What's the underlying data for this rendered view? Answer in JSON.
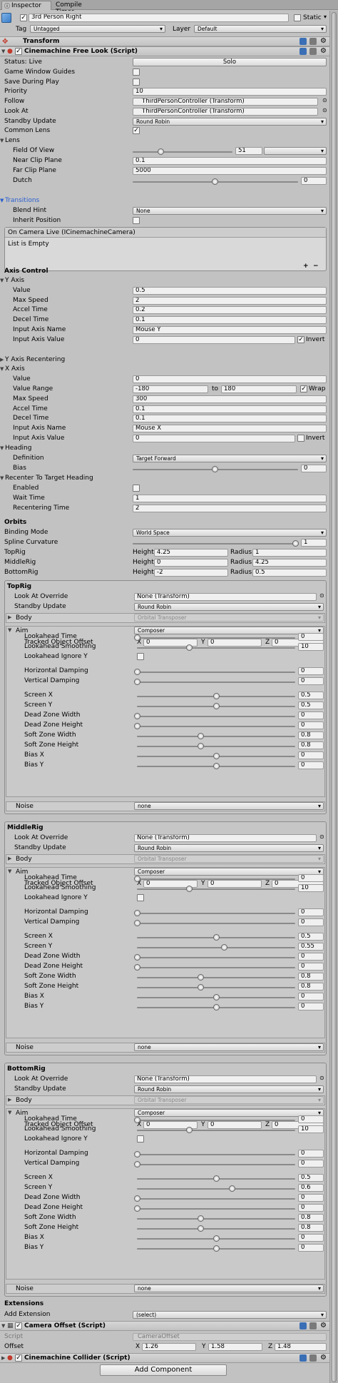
{
  "tabs": {
    "inspector": "Inspector",
    "compile_timer": "Compile Timer"
  },
  "go": {
    "name": "3rd Person Right",
    "static": "Static",
    "tag_label": "Tag",
    "tag_value": "Untagged",
    "layer_label": "Layer",
    "layer_value": "Default"
  },
  "transform": {
    "title": "Transform"
  },
  "freelook": {
    "title": "Cinemachine Free Look (Script)",
    "status_label": "Status: Live",
    "solo": "Solo",
    "game_window_guides": "Game Window Guides",
    "save_during_play": "Save During Play",
    "priority_label": "Priority",
    "priority": "10",
    "follow_label": "Follow",
    "follow": "ThirdPersonController (Transform)",
    "lookat_label": "Look At",
    "lookat": "ThirdPersonController (Transform)",
    "standby_label": "Standby Update",
    "standby": "Round Robin",
    "common_lens": "Common Lens",
    "lens": "Lens",
    "fov_label": "Field Of View",
    "fov": "51",
    "near_label": "Near Clip Plane",
    "near": "0.1",
    "far_label": "Far Clip Plane",
    "far": "5000",
    "dutch_label": "Dutch",
    "dutch": "0",
    "transitions": "Transitions",
    "blend_hint_label": "Blend Hint",
    "blend_hint": "None",
    "inherit_position": "Inherit Position",
    "on_camera_live": "On Camera Live (ICinemachineCamera)",
    "list_empty": "List is Empty",
    "plus": "+",
    "minus": "−"
  },
  "axis": {
    "title": "Axis Control",
    "y_axis": "Y Axis",
    "value_label": "Value",
    "y_value": "0.5",
    "max_speed_label": "Max Speed",
    "y_max_speed": "2",
    "accel_label": "Accel Time",
    "y_accel": "0.2",
    "decel_label": "Decel Time",
    "y_decel": "0.1",
    "input_name_label": "Input Axis Name",
    "y_input_name": "Mouse Y",
    "input_value_label": "Input Axis Value",
    "y_input_value": "0",
    "invert": "Invert",
    "y_recentering": "Y Axis Recentering",
    "x_axis": "X Axis",
    "x_value": "0",
    "value_range_label": "Value Range",
    "x_range_min": "-180",
    "to": "to",
    "x_range_max": "180",
    "wrap": "Wrap",
    "x_max_speed": "300",
    "x_accel": "0.1",
    "x_decel": "0.1",
    "x_input_name": "Mouse X",
    "x_input_value": "0",
    "heading": "Heading",
    "definition_label": "Definition",
    "definition": "Target Forward",
    "bias_label": "Bias",
    "bias": "0",
    "recenter": "Recenter To Target Heading",
    "enabled": "Enabled",
    "wait_label": "Wait Time",
    "wait": "1",
    "recentering_label": "Recentering Time",
    "recentering": "2"
  },
  "orbits": {
    "title": "Orbits",
    "binding_label": "Binding Mode",
    "binding": "World Space",
    "spline_label": "Spline Curvature",
    "spline": "1",
    "height": "Height",
    "radius": "Radius",
    "top_label": "TopRig",
    "top_h": "4.25",
    "top_r": "1",
    "mid_label": "MiddleRig",
    "mid_h": "0",
    "mid_r": "4.25",
    "bot_label": "BottomRig",
    "bot_h": "-2",
    "bot_r": "0.5"
  },
  "rig_common": {
    "look_at_override": "Look At Override",
    "none_transform": "None (Transform)",
    "standby": "Standby Update",
    "round_robin": "Round Robin",
    "body": "Body",
    "orbital": "Orbital Transposer",
    "aim": "Aim",
    "composer": "Composer",
    "tracked": "Tracked Object Offset",
    "x": "X",
    "y": "Y",
    "z": "Z",
    "lookahead_time": "Lookahead Time",
    "lookahead_smoothing": "Lookahead Smoothing",
    "lookahead_ignore_y": "Lookahead Ignore Y",
    "hdamp": "Horizontal Damping",
    "vdamp": "Vertical Damping",
    "screen_x": "Screen X",
    "screen_y": "Screen Y",
    "dz_width": "Dead Zone Width",
    "dz_height": "Dead Zone Height",
    "sz_width": "Soft Zone Width",
    "sz_height": "Soft Zone Height",
    "bias_x": "Bias X",
    "bias_y": "Bias Y",
    "noise": "Noise",
    "noise_value": "none"
  },
  "rigs": [
    {
      "title": "TopRig",
      "tx": "0",
      "ty": "0",
      "tz": "0",
      "lt": "0",
      "ls": "10",
      "hd": "0",
      "vd": "0",
      "sx": "0.5",
      "sy": "0.5",
      "dzw": "0",
      "dzh": "0",
      "szw": "0.8",
      "szh": "0.8",
      "bx": "0",
      "by": "0"
    },
    {
      "title": "MiddleRig",
      "tx": "0",
      "ty": "0",
      "tz": "0",
      "lt": "0",
      "ls": "10",
      "hd": "0",
      "vd": "0",
      "sx": "0.5",
      "sy": "0.55",
      "dzw": "0",
      "dzh": "0",
      "szw": "0.8",
      "szh": "0.8",
      "bx": "0",
      "by": "0"
    },
    {
      "title": "BottomRig",
      "tx": "0",
      "ty": "0",
      "tz": "0",
      "lt": "0",
      "ls": "10",
      "hd": "0",
      "vd": "0",
      "sx": "0.5",
      "sy": "0.6",
      "dzw": "0",
      "dzh": "0",
      "szw": "0.8",
      "szh": "0.8",
      "bx": "0",
      "by": "0"
    }
  ],
  "extensions": {
    "title": "Extensions",
    "add_label": "Add Extension",
    "add_value": "(select)"
  },
  "camera_offset": {
    "title": "Camera Offset (Script)",
    "script_label": "Script",
    "script": "CameraOffset",
    "offset_label": "Offset",
    "x": "1.26",
    "y": "1.58",
    "z": "1.48"
  },
  "collider": {
    "title": "Cinemachine Collider (Script)"
  },
  "add_component": "Add Component"
}
